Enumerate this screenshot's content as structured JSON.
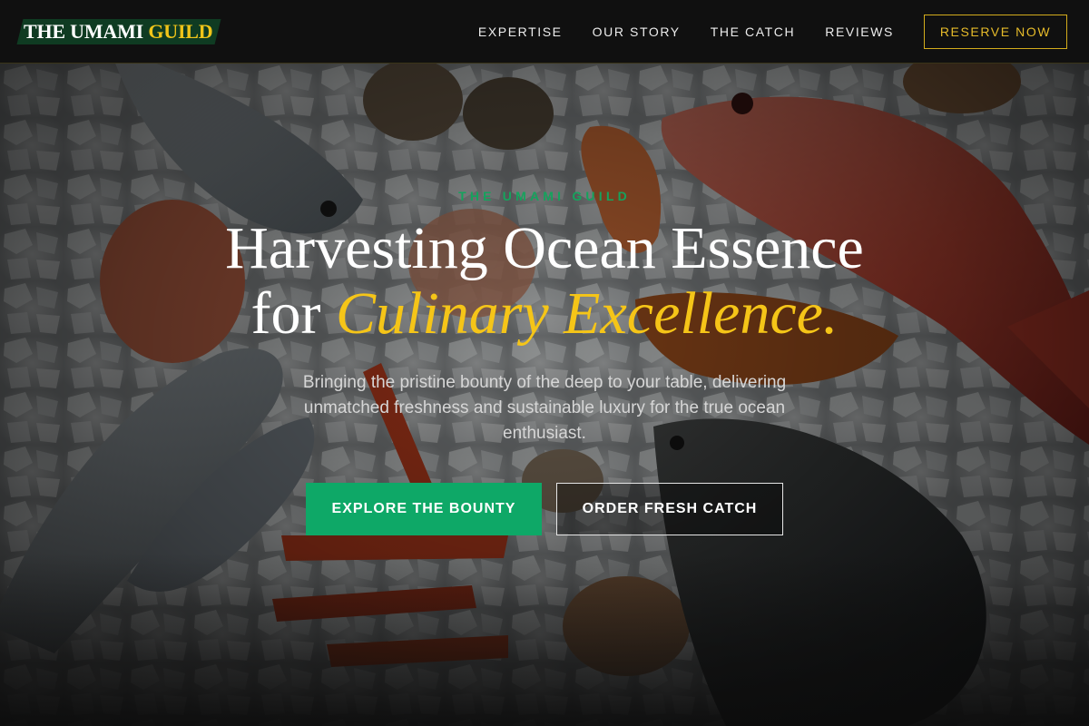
{
  "brand": {
    "logo_part1": "THE UMAMI",
    "logo_part2": "GUILD"
  },
  "nav": {
    "links": [
      "EXPERTISE",
      "OUR STORY",
      "THE CATCH",
      "REVIEWS"
    ],
    "reserve_label": "RESERVE NOW"
  },
  "hero": {
    "eyebrow": "THE UMAMI GUILD",
    "headline_line1": "Harvesting Ocean Essence",
    "headline_line2_plain": "for",
    "headline_line2_accent": "Culinary Excellence.",
    "subtext": "Bringing the pristine bounty of the deep to your table, delivering unmatched freshness and sustainable luxury for the true ocean enthusiast.",
    "primary_cta": "EXPLORE THE BOUNTY",
    "secondary_cta": "ORDER FRESH CATCH"
  },
  "colors": {
    "header_bg": "#101010",
    "accent_gold": "#f5c518",
    "accent_green": "#0ea867",
    "logo_bg": "#0f3b22"
  }
}
